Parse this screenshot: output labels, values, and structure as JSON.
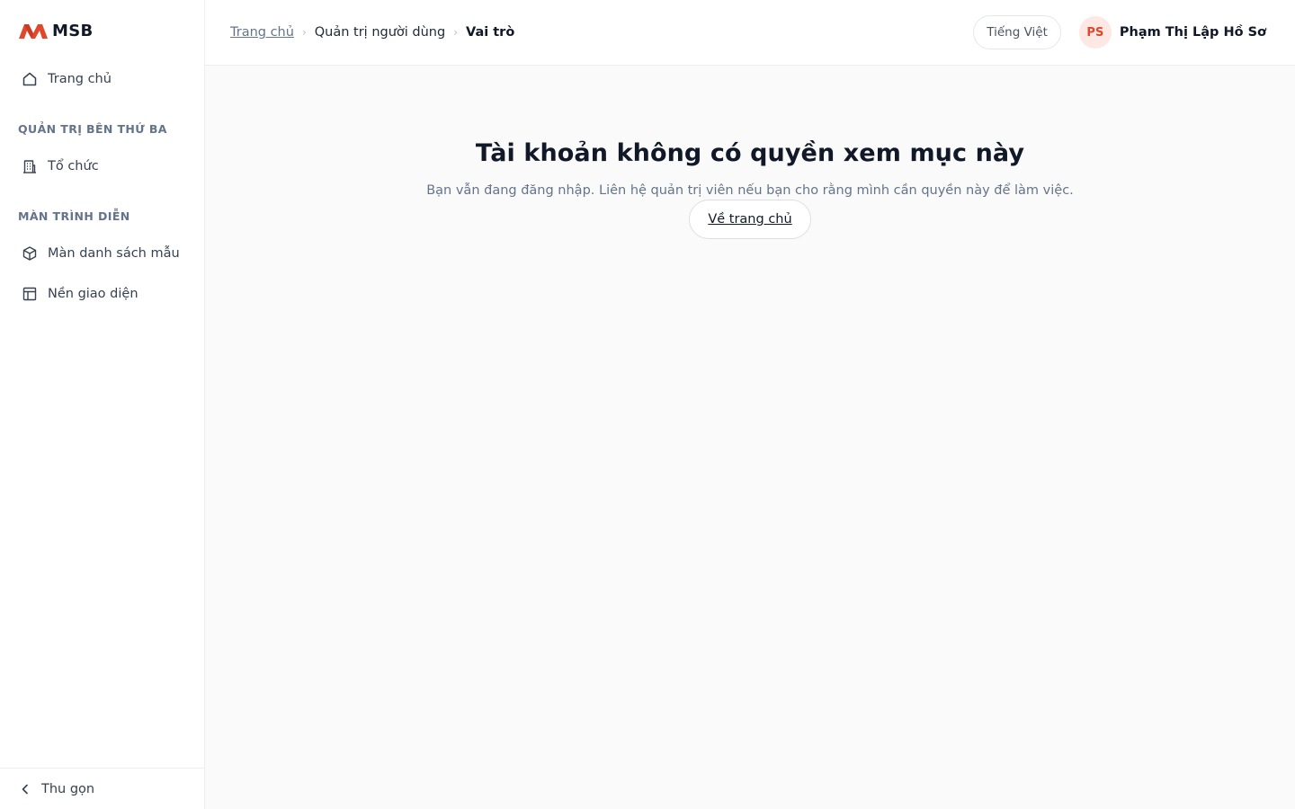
{
  "brand": {
    "logo_text": "MSB",
    "accent_color": "#e0472b"
  },
  "sidebar": {
    "home": {
      "label": "Trang chủ",
      "icon": "home-icon"
    },
    "sections": [
      {
        "title": "QUẢN TRỊ BÊN THỨ BA",
        "items": [
          {
            "label": "Tổ chức",
            "icon": "building-icon"
          }
        ]
      },
      {
        "title": "MÀN TRÌNH DIỄN",
        "items": [
          {
            "label": "Màn danh sách mẫu",
            "icon": "box-icon"
          },
          {
            "label": "Nền giao diện",
            "icon": "layout-icon"
          }
        ]
      }
    ],
    "collapse_label": "Thu gọn"
  },
  "header": {
    "breadcrumb": [
      "Trang chủ",
      "Quản trị người dùng",
      "Vai trò"
    ],
    "language_label": "Tiếng Việt",
    "user": {
      "initials": "PS",
      "name": "Phạm Thị Lập Hồ Sơ"
    }
  },
  "main": {
    "title": "Tài khoản không có quyền xem mục này",
    "message": "Bạn vẫn đang đăng nhập. Liên hệ quản trị viên nếu bạn cho rằng mình cần quyền này để làm việc.",
    "home_button_label": "Về trang chủ"
  }
}
